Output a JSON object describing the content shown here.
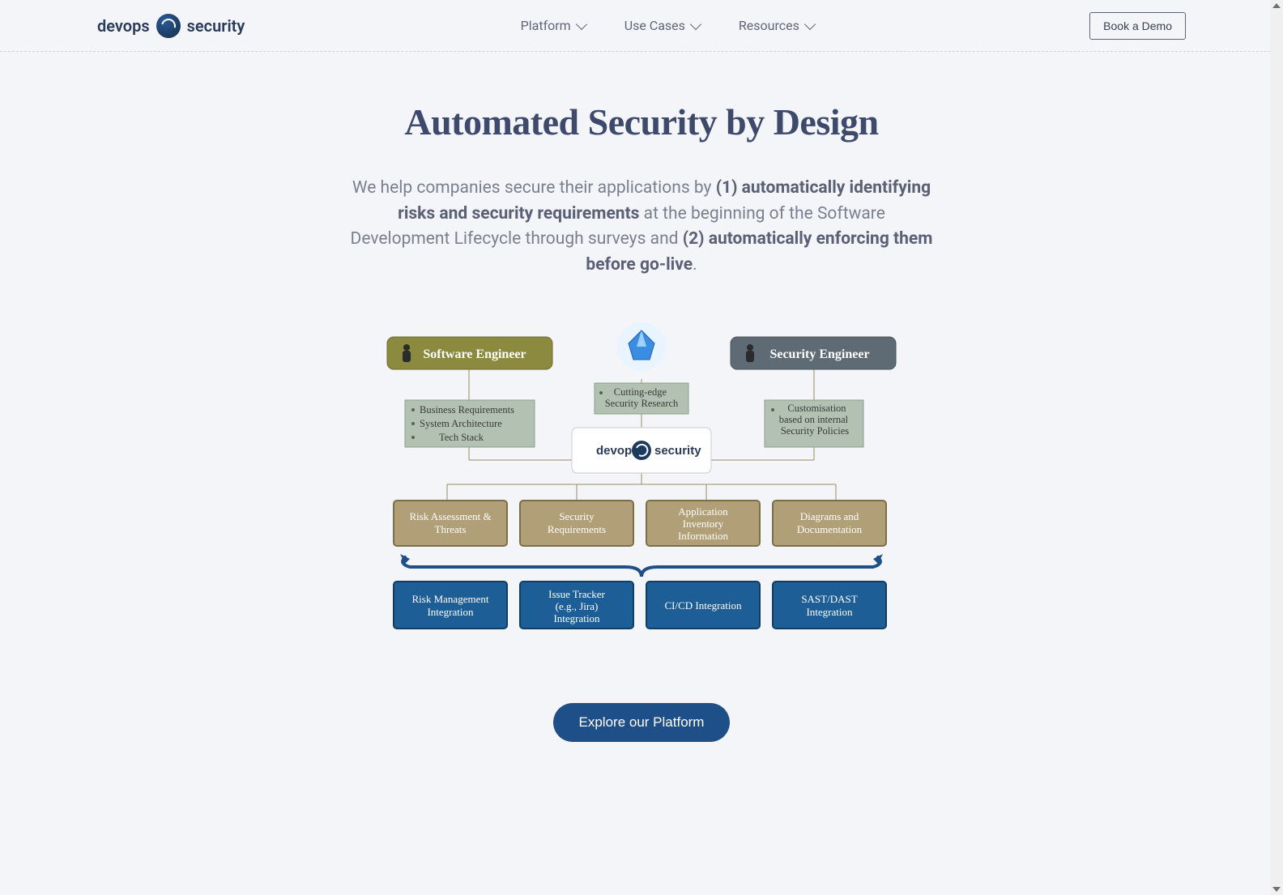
{
  "logo": {
    "left": "devops",
    "right": "security"
  },
  "nav": {
    "items": [
      {
        "label": "Platform"
      },
      {
        "label": "Use Cases"
      },
      {
        "label": "Resources"
      }
    ]
  },
  "demo_button": "Book a Demo",
  "hero": {
    "title": "Automated Security by Design",
    "desc_pre": "We help companies secure their applications by ",
    "desc_b1": "(1) automatically identifying risks and security requirements",
    "desc_mid": " at the beginning of the Software Development Lifecycle through surveys and ",
    "desc_b2": "(2) automatically enforcing them before go-live",
    "desc_post": "."
  },
  "diagram": {
    "role_left": "Software Engineer",
    "role_right": "Security Engineer",
    "center_top": "Cutting-edge Security Research",
    "left_box_items": [
      "Business Requirements",
      "System Architecture",
      "Tech Stack"
    ],
    "right_box": "Customisation based on internal Security Policies",
    "center_logo_left": "devops",
    "center_logo_right": "security",
    "outputs": [
      "Risk Assessment & Threats",
      "Security Requirements",
      "Application Inventory Information",
      "Diagrams and Documentation"
    ],
    "integrations": [
      "Risk Management Integration",
      "Issue Tracker (e.g., Jira) Integration",
      "CI/CD Integration",
      "SAST/DAST Integration"
    ]
  },
  "explore_button": "Explore our Platform"
}
